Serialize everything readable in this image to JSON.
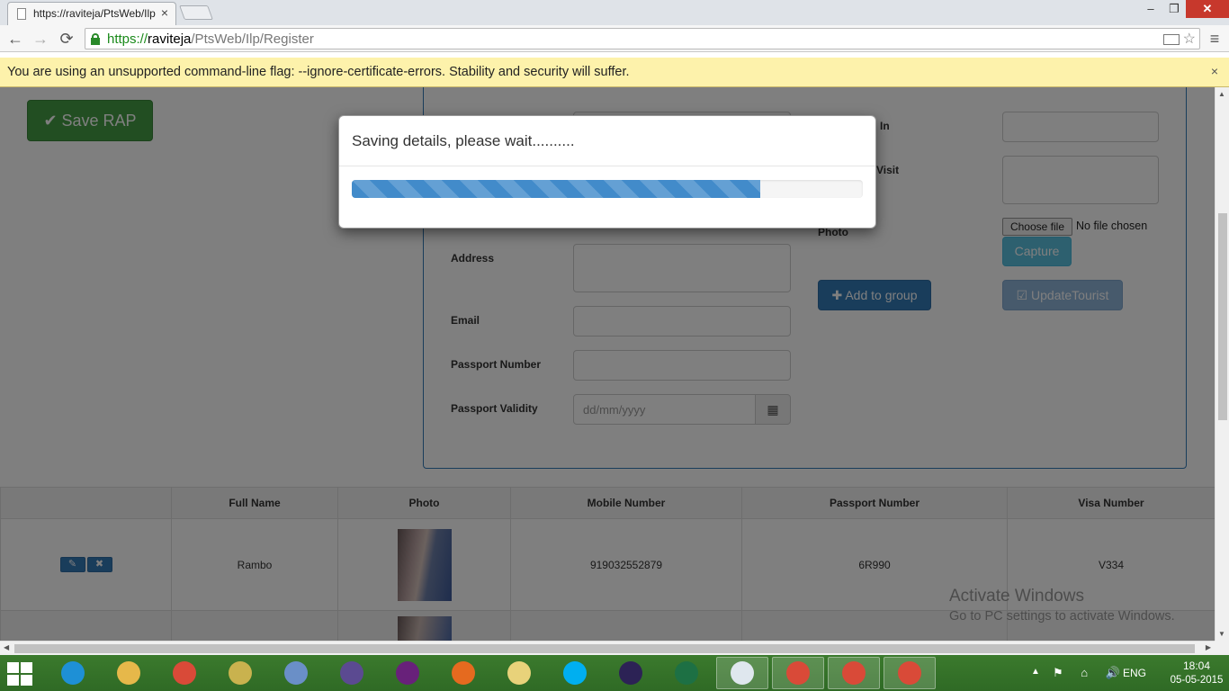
{
  "browser": {
    "tab_title": "https://raviteja/PtsWeb/Ilp",
    "tab_close": "×",
    "url_scheme": "https://",
    "url_host": "raviteja",
    "url_path": "/PtsWeb/Ilp/Register",
    "window_min": "–",
    "window_max": "❐",
    "window_close": "✕",
    "back": "←",
    "forward": "→",
    "reload": "⟳",
    "star": "☆",
    "menu": "≡"
  },
  "infobar": {
    "message": "You are using an unsupported command-line flag: --ignore-certificate-errors. Stability and security will suffer.",
    "close": "×"
  },
  "page": {
    "save_button": "✔ Save RAP",
    "fields": {
      "address_label": "Address",
      "email_label": "Email",
      "passport_number_label": "Passport Number",
      "passport_validity_label": "Passport Validity",
      "passport_validity_placeholder": "dd/mm/yyyy",
      "partial_label_1": "In",
      "partial_label_2": "Visit",
      "photo_label": "Photo"
    },
    "choose_file_button": "Choose file",
    "no_file_text": "No file chosen",
    "capture_button": "Capture",
    "add_to_group_button": "✚ Add to group",
    "update_tourist_button": "☑ UpdateTourist",
    "calendar_icon": "▦"
  },
  "table": {
    "headers": [
      "",
      "Full Name",
      "Photo",
      "Mobile Number",
      "Passport Number",
      "Visa Number"
    ],
    "rows": [
      {
        "full_name": "Rambo",
        "mobile": "919032552879",
        "passport": "6R990",
        "visa": "V334"
      }
    ],
    "edit_icon": "✎",
    "delete_icon": "✖"
  },
  "watermark": {
    "line1": "Activate Windows",
    "line2": "Go to PC settings to activate Windows."
  },
  "modal": {
    "title": "Saving details, please wait..........",
    "progress_percent": 80
  },
  "taskbar": {
    "apps": [
      {
        "name": "internet-explorer-icon",
        "color": "#1e90d6"
      },
      {
        "name": "file-explorer-icon",
        "color": "#e6b84a"
      },
      {
        "name": "chrome-icon",
        "color": "#d94a38"
      },
      {
        "name": "tools-icon",
        "color": "#c9b24e"
      },
      {
        "name": "network-icon",
        "color": "#6a8fc7"
      },
      {
        "name": "eclipse-purple-icon",
        "color": "#5b4a91"
      },
      {
        "name": "visual-studio-icon",
        "color": "#68217a"
      },
      {
        "name": "firefox-icon",
        "color": "#e56a1f"
      },
      {
        "name": "folder-icon",
        "color": "#e8d27a"
      },
      {
        "name": "skype-icon",
        "color": "#00aff0"
      },
      {
        "name": "eclipse-icon",
        "color": "#2c2255"
      },
      {
        "name": "excel-icon",
        "color": "#1d7044"
      },
      {
        "name": "news-icon",
        "color": "#dfe7ee"
      },
      {
        "name": "chrome-icon",
        "color": "#d94a38"
      },
      {
        "name": "chrome-icon",
        "color": "#d94a38"
      },
      {
        "name": "chrome-icon",
        "color": "#d94a38"
      }
    ],
    "tray_arrow": "▲",
    "tray_icons": "⚑ ⌂ 🔊",
    "language": "ENG",
    "time": "18:04",
    "date": "05-05-2015"
  }
}
